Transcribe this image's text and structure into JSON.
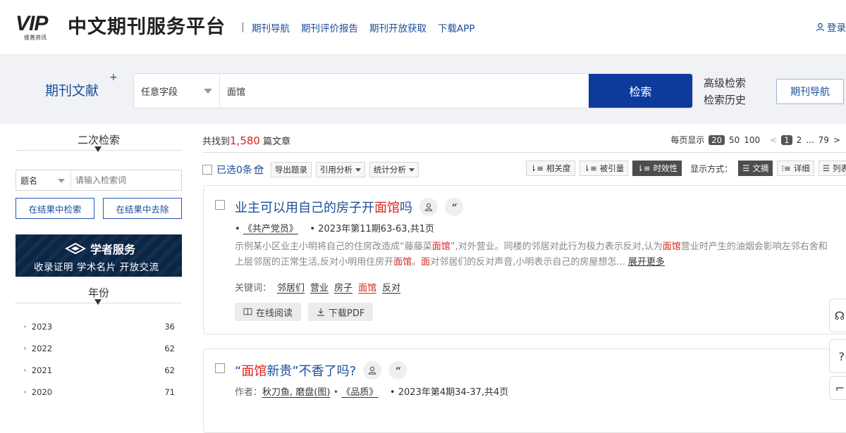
{
  "header": {
    "logo_text": "VIP",
    "logo_subtext": "维普资讯",
    "site_title": "中文期刊服务平台",
    "nav": [
      "期刊导航",
      "期刊评价报告",
      "期刊开放获取",
      "下载APP"
    ],
    "login": "登录"
  },
  "search": {
    "tag": "期刊文献",
    "tag_sup": "+",
    "field": "任意字段",
    "keyword": "面馆",
    "button": "检索",
    "advanced": "高级检索",
    "history": "检索历史",
    "journal_nav": "期刊导航"
  },
  "sidebar": {
    "refine_title": "二次检索",
    "field": "题名",
    "input_placeholder": "请输入检索词",
    "btn_within": "在结果中检索",
    "btn_exclude": "在结果中去除",
    "banner_title": "学者服务",
    "banner_sub": "收录证明  学术名片  开放交流",
    "year_title": "年份",
    "years": [
      {
        "year": "2023",
        "count": "36"
      },
      {
        "year": "2022",
        "count": "62"
      },
      {
        "year": "2021",
        "count": "62"
      },
      {
        "year": "2020",
        "count": "71"
      }
    ]
  },
  "results": {
    "found_prefix": "共找到",
    "found_count": "1,580",
    "found_suffix": "篇文章",
    "per_page_label": "每页显示",
    "per_page_options": [
      "20",
      "50",
      "100"
    ],
    "pages": [
      "<",
      "1",
      "2",
      "...",
      "79",
      ">"
    ],
    "selected": "已选0条",
    "export": "导出题录",
    "cite_analysis": "引用分析",
    "stat_analysis": "统计分析",
    "sort_relevance": "相关度",
    "sort_cited": "被引量",
    "sort_timely": "时效性",
    "display_label": "显示方式：",
    "view_abstract": "文摘",
    "view_detail": "详细",
    "view_list": "列表"
  },
  "articles": [
    {
      "title_pre": "业主可以用自己的房子开",
      "title_hl": "面馆",
      "title_post": "吗",
      "journal": "《共产党员》",
      "issue": "2023年第11期63-63,共1页",
      "abstract_1": "示例某小区业主小明将自己的住房改造成“藤藤菜",
      "abstract_hl1": "面馆",
      "abstract_2": "”,对外营业。同楼的邻居对此行为极力表示反对,认为",
      "abstract_hl2": "面馆",
      "abstract_3": "营业时产生的油烟会影响左邻右舍和上层邻居的正常生活,反对小明用住房开",
      "abstract_hl3": "面馆",
      "abstract_4": "。",
      "abstract_hl4": "面",
      "abstract_5": "对邻居们的反对声音,小明表示自己的房屋想怎... ",
      "more": "展开更多",
      "keywords_label": "关键词：",
      "keywords": [
        "邻居们",
        "营业",
        "房子",
        "面馆",
        "反对"
      ],
      "read": "在线阅读",
      "download": "下载PDF"
    },
    {
      "title_open": "“",
      "title_hl": "面馆",
      "title_post": "新贵”不香了吗?",
      "author_label": "作者：",
      "authors": "秋刀鱼, 磨盘(图)",
      "journal": "《品质》",
      "issue": "2023年第4期34-37,共4页"
    }
  ]
}
